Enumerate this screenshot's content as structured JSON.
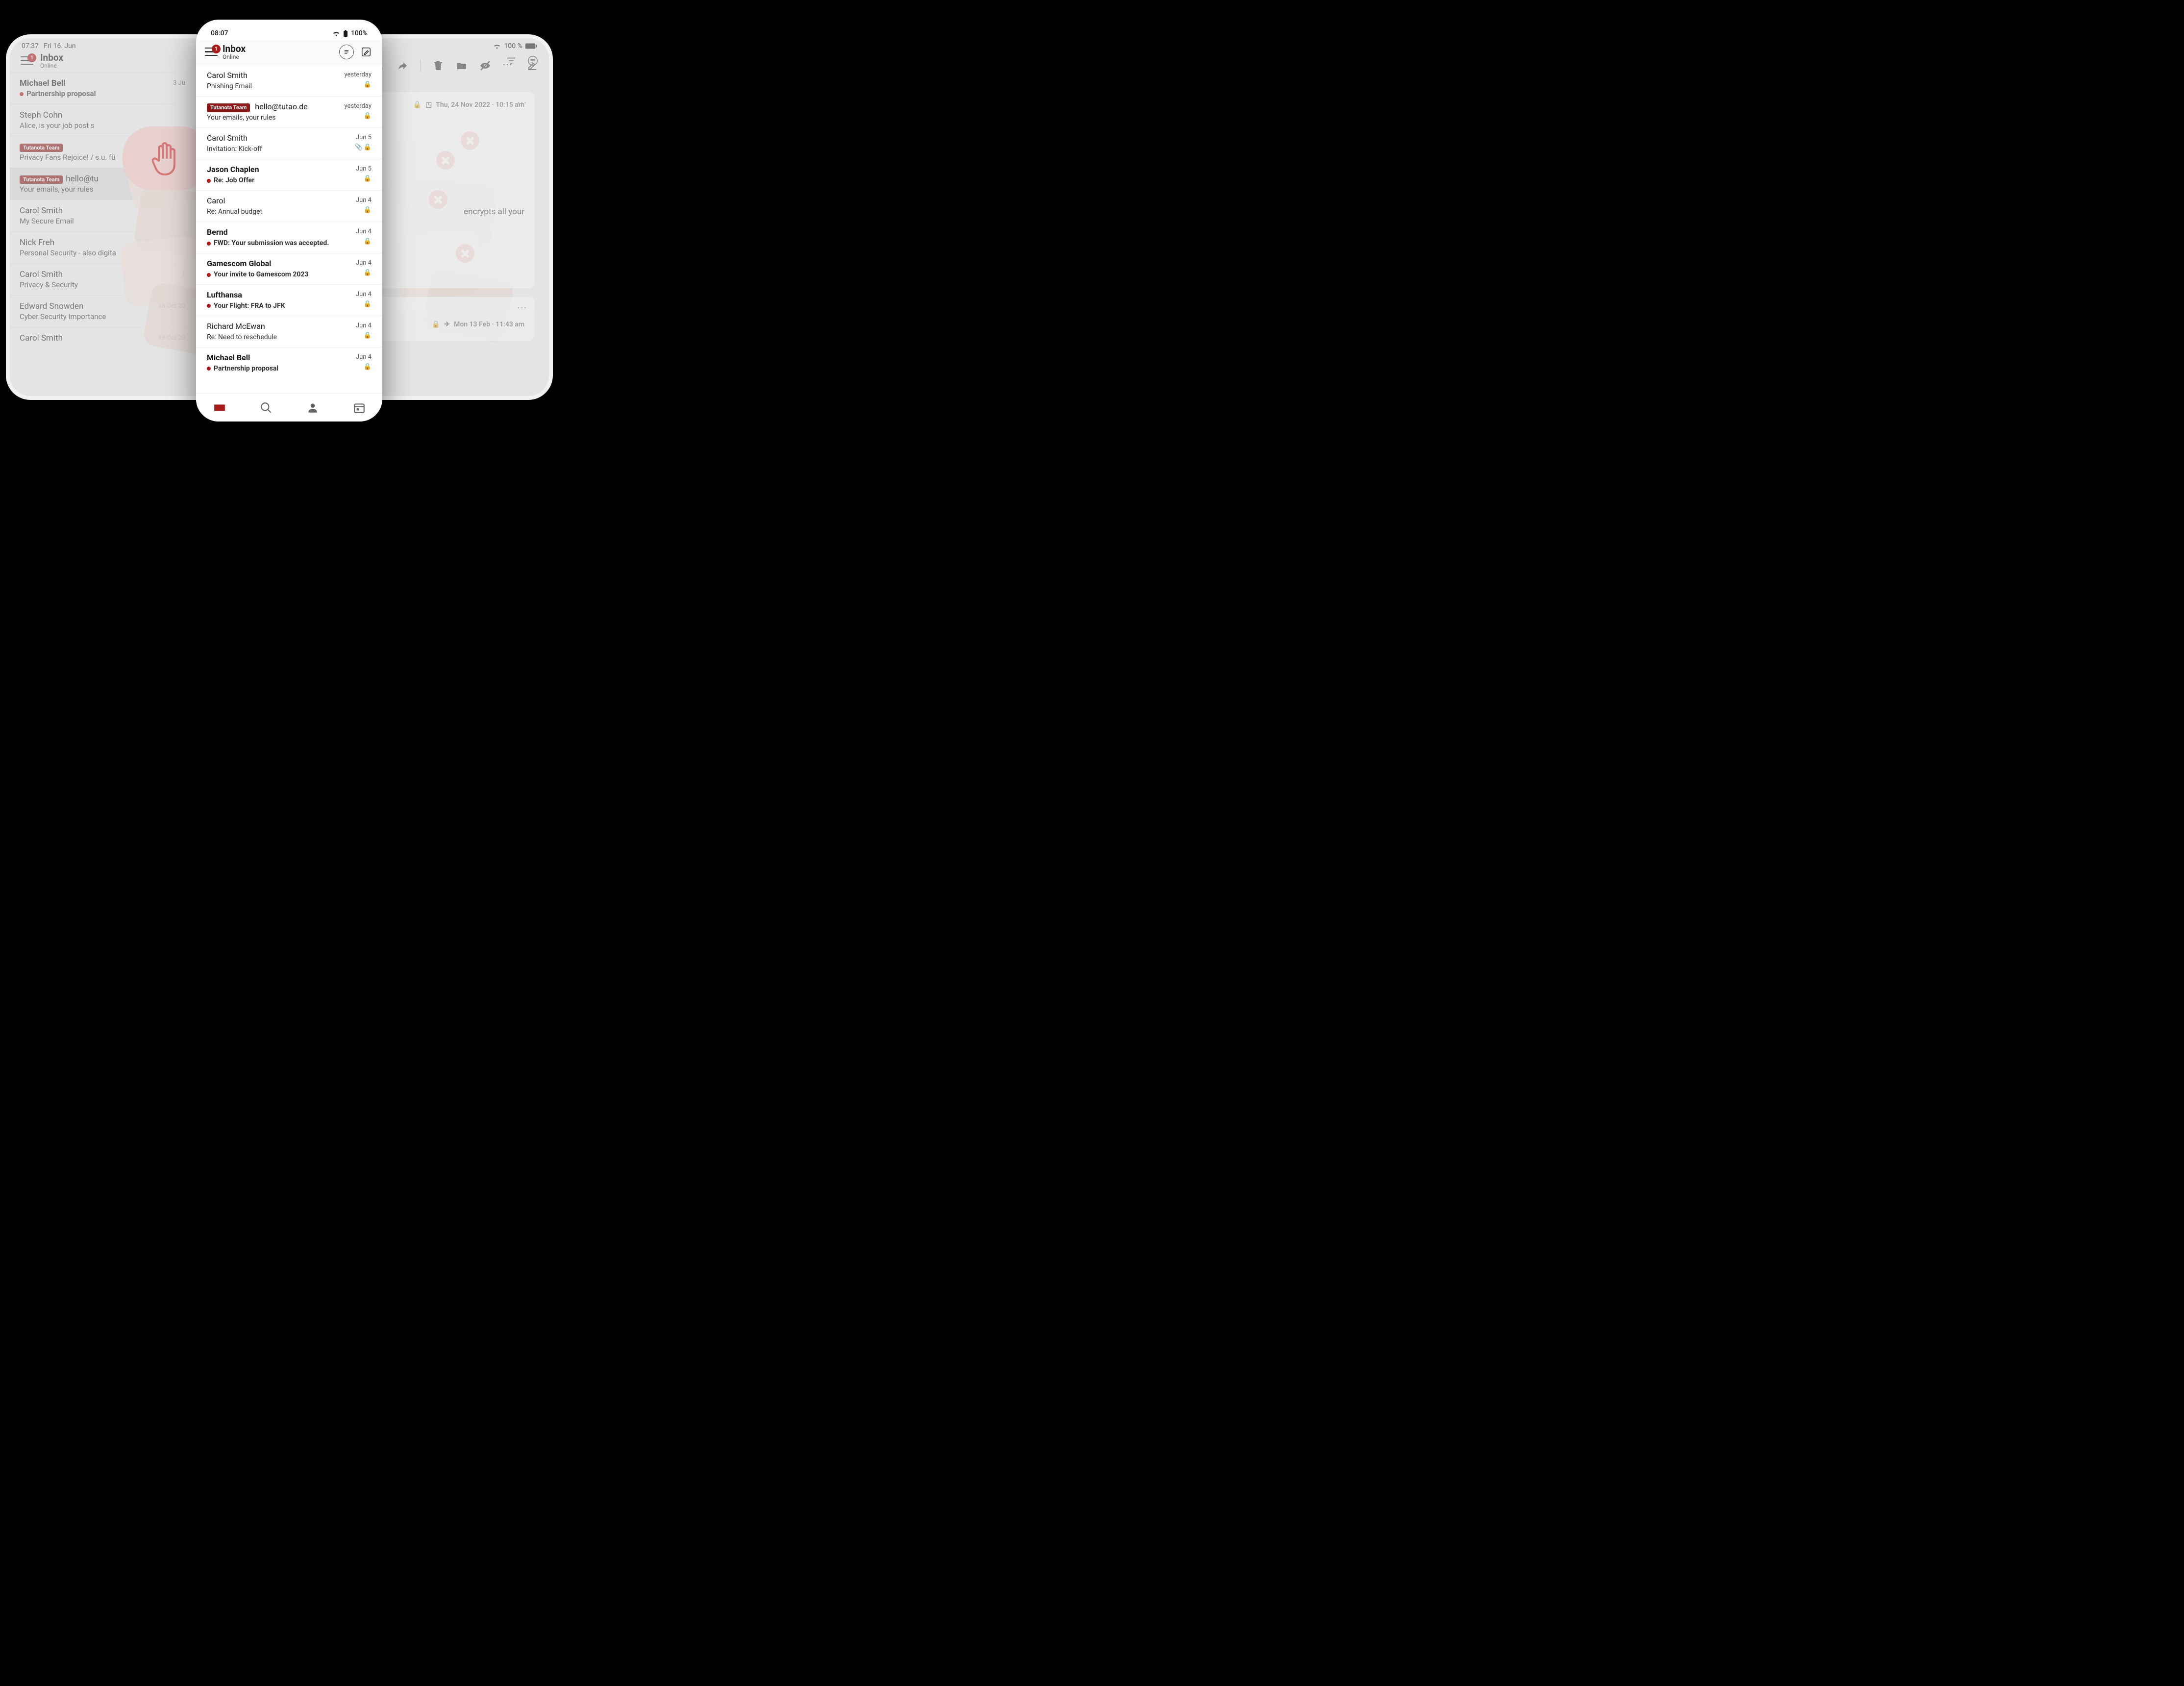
{
  "colors": {
    "accent": "#a91b1b",
    "danger": "#d32323"
  },
  "tablet": {
    "status": {
      "time": "07:37",
      "date": "Fri 16. Jun",
      "battery_label": "100 %"
    },
    "badge_count": "1",
    "title": "Inbox",
    "online": "Online",
    "toolbar_icons": [
      "filter",
      "thread",
      "reply",
      "reply-all",
      "forward",
      "sep",
      "trash",
      "folder",
      "hide",
      "more",
      "compose"
    ],
    "emails": [
      {
        "sender": "Michael Bell",
        "subject": "Partnership proposal",
        "date": "3 Ju",
        "unread": true
      },
      {
        "sender": "Steph Cohn",
        "subject": "Alice, is your job post s",
        "date": "",
        "unread": false
      },
      {
        "sender_badge": "Tutanota Team",
        "sender": "",
        "subject": "Privacy Fans Rejoice! / s.u. fü",
        "date": "",
        "unread": false
      },
      {
        "sender_badge": "Tutanota Team",
        "sender": "hello@tu",
        "subject": "Your emails, your rules",
        "date": "",
        "unread": false,
        "selected": true
      },
      {
        "sender": "Carol Smith",
        "subject": "My Secure Email",
        "date": "",
        "unread": false
      },
      {
        "sender": "Nick Freh",
        "subject": "Personal Security - also digita",
        "date": "",
        "unread": false
      },
      {
        "sender": "Carol Smith",
        "subject": "Privacy & Security",
        "date": "1",
        "unread": false
      },
      {
        "sender": "Edward Snowden",
        "subject": "Cyber Security Importance",
        "date": "18 Oct 20",
        "unread": false
      },
      {
        "sender": "Carol Smith",
        "subject": "",
        "date": "18 Oct 20",
        "unread": false
      }
    ],
    "detail1": {
      "meta": "Thu, 24 Nov 2022 · 10:15 am",
      "body_fragment": "encrypts all your"
    },
    "detail2": {
      "meta": "Mon 13 Feb · 11:43 am"
    }
  },
  "phone": {
    "status": {
      "time": "08:07",
      "battery_label": "100%"
    },
    "badge_count": "1",
    "title": "Inbox",
    "online": "Online",
    "emails": [
      {
        "sender": "Carol Smith",
        "subject": "Phishing Email",
        "date": "yesterday",
        "unread": false,
        "lock": true
      },
      {
        "sender_badge": "Tutanota Team",
        "sender": "hello@tutao.de",
        "subject": "Your emails, your rules",
        "date": "yesterday",
        "unread": false,
        "lock": true
      },
      {
        "sender": "Carol Smith",
        "subject": "Invitation: Kick-off",
        "date": "Jun 5",
        "unread": false,
        "lock": true,
        "attach": true
      },
      {
        "sender": "Jason Chaplen",
        "subject": "Re: Job Offer",
        "date": "Jun 5",
        "unread": true,
        "lock": true
      },
      {
        "sender": "Carol",
        "subject": "Re: Annual budget",
        "date": "Jun 4",
        "unread": false,
        "lock": true
      },
      {
        "sender": "Bernd",
        "subject": "FWD: Your submission was accepted.",
        "date": "Jun 4",
        "unread": true,
        "lock": true
      },
      {
        "sender": "Gamescom Global",
        "subject": "Your invite to Gamescom 2023",
        "date": "Jun 4",
        "unread": true,
        "lock": true
      },
      {
        "sender": "Lufthansa",
        "subject": "Your Flight: FRA to JFK",
        "date": "Jun 4",
        "unread": true,
        "lock": true
      },
      {
        "sender": "Richard McEwan",
        "subject": "Re: Need to reschedule",
        "date": "Jun 4",
        "unread": false,
        "lock": true
      },
      {
        "sender": "Michael Bell",
        "subject": "Partnership proposal",
        "date": "Jun 4",
        "unread": true,
        "lock": true
      }
    ],
    "nav": [
      "mail",
      "search",
      "contacts",
      "calendar"
    ]
  }
}
